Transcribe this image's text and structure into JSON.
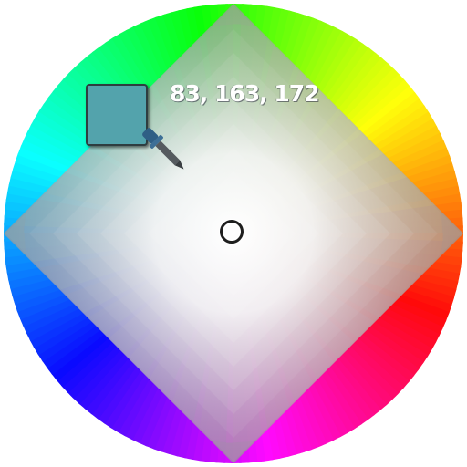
{
  "picker": {
    "rgb_readout": "83, 163, 172",
    "selected_color": "#53a3ac"
  },
  "icons": {
    "eyedropper": "eyedropper-icon",
    "cursor": "color-cursor-ring"
  }
}
